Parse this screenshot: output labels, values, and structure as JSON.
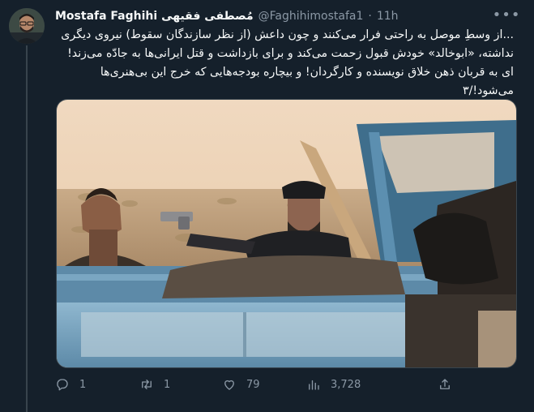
{
  "tweet": {
    "display_name": "Mostafa Faghihi مُصطفی فقیهی",
    "handle": "@Faghihimostafa1",
    "separator": "·",
    "time": "11h",
    "more_icon": "more-horizontal-icon",
    "text_lines": [
      "...از وسطِ موصل به راحتی فرار می‌کنند و چون داعش (از نظر سازندگان سقوط) نیروی دیگری",
      "نداشته، «ابوخالد» خودش قبول زحمت می‌کند و برای بازداشت و قتل ایرانی‌ها به جادّه می‌زند!",
      "ای به قربان ذهن خلاق نویسنده و کارگردان! و بیچاره بودجه‌هایی که خرج این بی‌هنری‌ها",
      "می‌شود!/۳"
    ]
  },
  "actions": {
    "reply": {
      "icon": "reply-icon",
      "count": "1"
    },
    "retweet": {
      "icon": "retweet-icon",
      "count": "1"
    },
    "like": {
      "icon": "heart-icon",
      "count": "79"
    },
    "views": {
      "icon": "views-icon",
      "count": "3,728"
    },
    "share": {
      "icon": "share-icon"
    }
  },
  "colors": {
    "background": "#15202b",
    "text": "#f7f9f9",
    "secondary": "#8b98a5",
    "border": "#38444d"
  }
}
